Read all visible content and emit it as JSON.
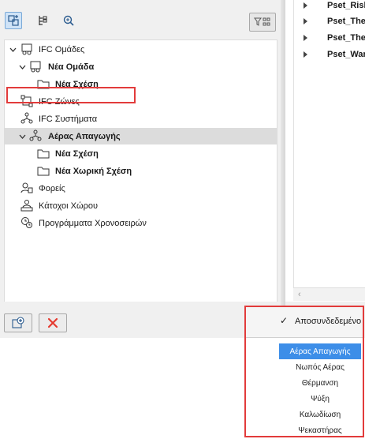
{
  "left_toolbar": {
    "icons": [
      "add-tree-icon",
      "hierarchy-icon",
      "search-icon",
      "filter-icon"
    ]
  },
  "tree": {
    "rows": [
      {
        "label": "IFC Ομάδες",
        "bold": false,
        "expanded": true,
        "icon": "group-icon"
      },
      {
        "label": "Νέα Ομάδα",
        "bold": true,
        "expanded": true,
        "icon": "group-icon"
      },
      {
        "label": "Νέα Σχέση",
        "bold": true,
        "icon": "folder-icon"
      },
      {
        "label": "IFC Ζώνες",
        "bold": false,
        "icon": "zone-icon"
      },
      {
        "label": "IFC Συστήματα",
        "bold": false,
        "expanded": true,
        "icon": "system-icon"
      },
      {
        "label": "Αέρας Απαγωγής",
        "bold": true,
        "expanded": true,
        "selected": true,
        "icon": "system-icon"
      },
      {
        "label": "Νέα Σχέση",
        "bold": true,
        "icon": "folder-icon"
      },
      {
        "label": "Νέα Χωρική Σχέση",
        "bold": true,
        "icon": "folder-icon"
      },
      {
        "label": "Φορείς",
        "bold": false,
        "icon": "actor-icon"
      },
      {
        "label": "Κάτοχοι Χώρου",
        "bold": false,
        "icon": "occupant-icon"
      },
      {
        "label": "Προγράμματα Χρονοσειρών",
        "bold": false,
        "icon": "schedule-icon"
      }
    ]
  },
  "bottom_bar": {
    "icons": [
      "add-new-icon",
      "delete-icon"
    ],
    "colors": {
      "delete": "#e53a2f"
    }
  },
  "pset_list": {
    "items": [
      "Pset_Risk",
      "Pset_Ther",
      "Pset_Ther",
      "Pset_War"
    ]
  },
  "dropdown": {
    "top_check_label": "Αποσυνδεδεμένο",
    "items": [
      {
        "label": "Αέρας Απαγωγής",
        "selected": true
      },
      {
        "label": "Νωπός Αέρας",
        "selected": false
      },
      {
        "label": "Θέρμανση",
        "selected": false
      },
      {
        "label": "Ψύξη",
        "selected": false
      },
      {
        "label": "Καλωδίωση",
        "selected": false
      },
      {
        "label": "Ψεκαστήρας",
        "selected": false
      }
    ],
    "accent_color": "#3d8ee8"
  },
  "highlight_color": "#e23b3b"
}
